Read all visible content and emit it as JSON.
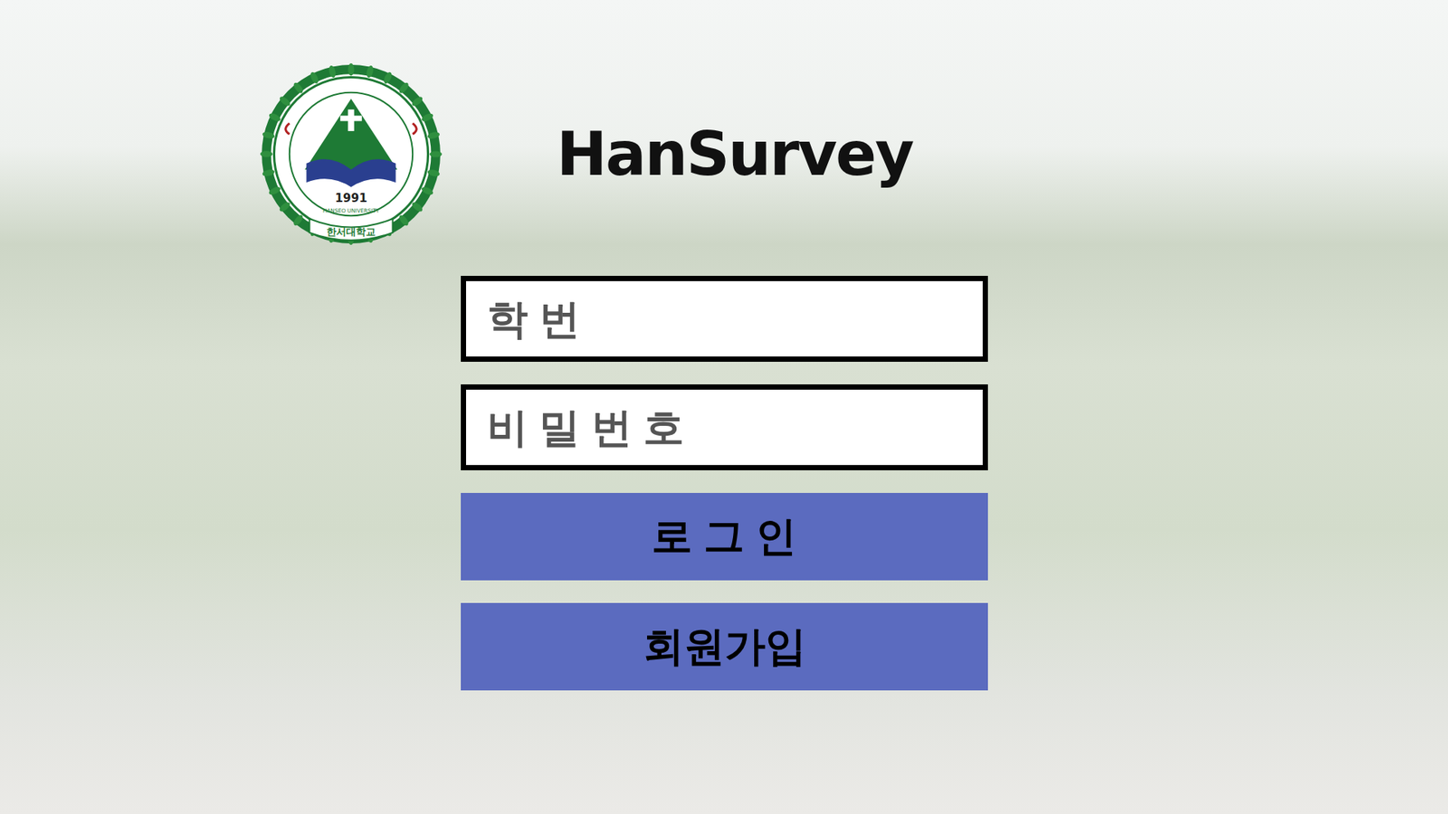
{
  "logo": {
    "year": "1991",
    "name": "한서대학교",
    "english": "HANSEO UNIVERSITY"
  },
  "title": "HanSurvey",
  "fields": [
    {
      "placeholder": "학 번",
      "kind": "text"
    },
    {
      "placeholder": "비 밀 번 호",
      "kind": "password"
    }
  ],
  "buttons": [
    "로 그 인",
    "회원가입"
  ]
}
